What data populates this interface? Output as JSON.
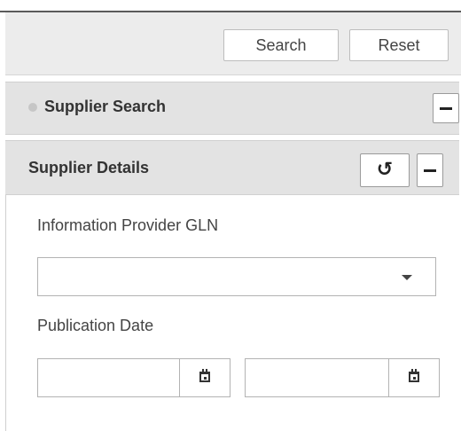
{
  "toolbar": {
    "search_label": "Search",
    "reset_label": "Reset"
  },
  "supplier_search_panel": {
    "title": "Supplier Search",
    "collapse_icon": "minus-icon"
  },
  "supplier_details_panel": {
    "title": "Supplier Details",
    "refresh_icon": "refresh-icon",
    "collapse_icon": "minus-icon",
    "fields": {
      "gln_label": "Information Provider GLN",
      "gln_value": "",
      "publication_date_label": "Publication Date",
      "date_from_value": "",
      "date_to_value": ""
    }
  },
  "colors": {
    "panel_header_bg": "#e3e3e3",
    "toolbar_bg": "#ececec",
    "border": "#b3b3b3"
  }
}
